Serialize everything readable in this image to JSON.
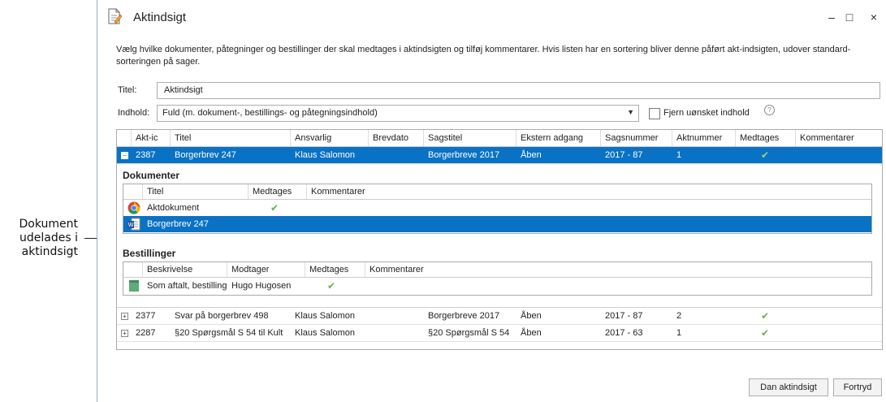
{
  "annotation": {
    "line1": "Dokument",
    "line2": "udelades i",
    "line3": "aktindsigt"
  },
  "window": {
    "title": "Aktindsigt",
    "minimize": "–",
    "maximize": "□",
    "close": "×"
  },
  "description": "Vælg hvilke dokumenter, påtegninger og bestillinger der skal medtages i aktindsigten og tilføj kommentarer. Hvis listen har en sortering bliver denne påført akt-indsigten, udover standard-sorteringen på sager.",
  "form": {
    "titel_label": "Titel:",
    "titel_value": "Aktindsigt",
    "indhold_label": "Indhold:",
    "indhold_value": "Fuld (m. dokument-, bestillings- og påtegningsindhold)",
    "remove_label": "Fjern uønsket indhold",
    "help": "?"
  },
  "grid": {
    "columns": [
      "Akt-ic",
      "Titel",
      "Ansvarlig",
      "Brevdato",
      "Sagstitel",
      "Ekstern adgang",
      "Sagsnummer",
      "Aktnummer",
      "Medtages",
      "Kommentarer"
    ],
    "rows": [
      {
        "id": "2387",
        "titel": "Borgerbrev 247",
        "ansvarlig": "Klaus Salomon",
        "brevdato": "",
        "sagstitel": "Borgerbreve 2017",
        "adgang": "Åben",
        "sagsnummer": "2017 - 87",
        "aktnummer": "1",
        "medtages": "✔",
        "expand": "−"
      },
      {
        "id": "2377",
        "titel": "Svar på borgerbrev 498",
        "ansvarlig": "Klaus Salomon",
        "brevdato": "",
        "sagstitel": "Borgerbreve 2017",
        "adgang": "Åben",
        "sagsnummer": "2017 - 87",
        "aktnummer": "2",
        "medtages": "✔",
        "expand": "+"
      },
      {
        "id": "2287",
        "titel": "§20 Spørgsmål S 54 til Kult",
        "ansvarlig": "Klaus Salomon",
        "brevdato": "",
        "sagstitel": "§20 Spørgsmål S 54",
        "adgang": "Åben",
        "sagsnummer": "2017 - 63",
        "aktnummer": "1",
        "medtages": "✔",
        "expand": "+"
      }
    ]
  },
  "dokumenter": {
    "heading": "Dokumenter",
    "columns": [
      "Titel",
      "Medtages",
      "Kommentarer"
    ],
    "rows": [
      {
        "titel": "Aktdokument",
        "medtages": "✔"
      },
      {
        "titel": "Borgerbrev 247",
        "medtages": ""
      }
    ]
  },
  "bestillinger": {
    "heading": "Bestillinger",
    "columns": [
      "Beskrivelse",
      "Modtager",
      "Medtages",
      "Kommentarer"
    ],
    "rows": [
      {
        "beskrivelse": "Som aftalt, bestilling pa",
        "modtager": "Hugo Hugosen",
        "medtages": "✔"
      }
    ]
  },
  "buttons": {
    "create": "Dan aktindsigt",
    "cancel": "Fortryd"
  },
  "colors": {
    "selection": "#0a72c4",
    "check": "#6ab04c"
  }
}
